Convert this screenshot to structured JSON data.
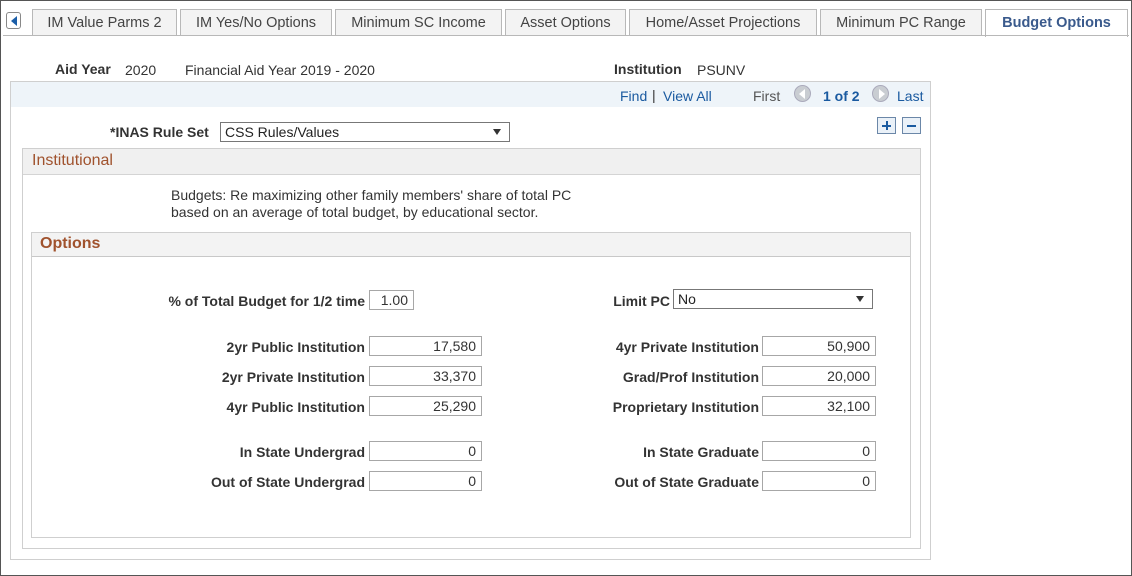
{
  "tabs": [
    {
      "label": "IM Value Parms 2"
    },
    {
      "label": "IM Yes/No Options"
    },
    {
      "label": "Minimum SC Income"
    },
    {
      "label": "Asset Options"
    },
    {
      "label": "Home/Asset Projections"
    },
    {
      "label": "Minimum PC Range"
    },
    {
      "label": "Budget Options"
    }
  ],
  "header": {
    "aid_year_label": "Aid Year",
    "aid_year_value": "2020",
    "aid_year_desc": "Financial Aid Year 2019 - 2020",
    "institution_label": "Institution",
    "institution_value": "PSUNV"
  },
  "nav": {
    "find": "Find",
    "separator": "|",
    "view_all": "View All",
    "first": "First",
    "page_indicator": "1 of 2",
    "last": "Last"
  },
  "rule_set": {
    "label": "*INAS Rule Set",
    "value": "CSS Rules/Values"
  },
  "institutional": {
    "title": "Institutional",
    "desc_line1": "Budgets: Re maximizing other family members' share of total PC",
    "desc_line2": "based on an average of total budget, by educational sector."
  },
  "options": {
    "title": "Options",
    "pct_label": "% of Total Budget for 1/2 time",
    "pct_value": "1.00",
    "limit_pc_label": "Limit PC",
    "limit_pc_value": "No",
    "fields": {
      "yr2_public_label": "2yr Public Institution",
      "yr2_public_value": "17,580",
      "yr2_private_label": "2yr Private Institution",
      "yr2_private_value": "33,370",
      "yr4_public_label": "4yr Public Institution",
      "yr4_public_value": "25,290",
      "yr4_private_label": "4yr Private Institution",
      "yr4_private_value": "50,900",
      "grad_prof_label": "Grad/Prof Institution",
      "grad_prof_value": "20,000",
      "proprietary_label": "Proprietary Institution",
      "proprietary_value": "32,100",
      "in_state_ug_label": "In State Undergrad",
      "in_state_ug_value": "0",
      "out_state_ug_label": "Out of State Undergrad",
      "out_state_ug_value": "0",
      "in_state_grad_label": "In State Graduate",
      "in_state_grad_value": "0",
      "out_state_grad_label": "Out of State Graduate",
      "out_state_grad_value": "0"
    }
  },
  "colors": {
    "link": "#1a5aa0",
    "section_title": "#a0522d",
    "active_tab_text": "#3a5a8c"
  }
}
